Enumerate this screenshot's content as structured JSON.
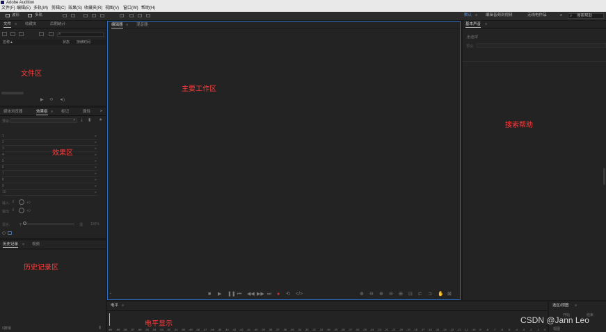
{
  "app": {
    "title": "Adobe Audition"
  },
  "menu": [
    "文件(F)",
    "编辑(E)",
    "多轨(M)",
    "剪辑(C)",
    "效果(S)",
    "收藏夹(R)",
    "视图(V)",
    "窗口(W)",
    "帮助(H)"
  ],
  "toolbar": {
    "waveform_label": "波形",
    "multitrack_label": "多轨",
    "workspace_default": "默认",
    "workspace_edit_video": "编辑音频到视频",
    "workspace_radio": "无线电作品",
    "search_placeholder": "搜索帮助"
  },
  "files_panel": {
    "tabs": [
      "文件",
      "收藏夹",
      "后期统计"
    ],
    "columns": {
      "name": "名称",
      "status": "状态",
      "duration": "持续时间"
    },
    "annotation": "文件区"
  },
  "effects_panel": {
    "tabs": [
      "媒体浏览器",
      "效果组",
      "标记",
      "属性"
    ],
    "preset_label": "预设:",
    "slots": [
      "1",
      "2",
      "3",
      "4",
      "5",
      "6",
      "7",
      "8",
      "9",
      "10"
    ],
    "input_label": "输入:",
    "output_label": "输出:",
    "gain_value": "+0",
    "mix_label": "混合:",
    "mix_left": "干",
    "mix_right": "湿",
    "mix_value": "100%",
    "annotation": "效果区"
  },
  "history_panel": {
    "tabs": [
      "历史记录",
      "视频"
    ],
    "status": "0撤销",
    "annotation": "历史记录区"
  },
  "editor_panel": {
    "tabs": [
      "编辑器",
      "混音器"
    ],
    "annotation": "主要工作区"
  },
  "essential_sound": {
    "tab": "基本声音",
    "no_selection": "无选择",
    "preset_label": "预设:",
    "annotation": "搜索帮助"
  },
  "levels_panel": {
    "tab": "电平",
    "annotation": "电平显示",
    "ruler": [
      "dB",
      "-59",
      "-58",
      "-57",
      "-56",
      "-55",
      "-54",
      "-53",
      "-52",
      "-51",
      "-50",
      "-49",
      "-48",
      "-47",
      "-46",
      "-45",
      "-44",
      "-43",
      "-42",
      "-41",
      "-40",
      "-39",
      "-38",
      "-37",
      "-36",
      "-35",
      "-34",
      "-33",
      "-32",
      "-31",
      "-30",
      "-29",
      "-28",
      "-27",
      "-26",
      "-25",
      "-24",
      "-23",
      "-22",
      "-21",
      "-20",
      "-19",
      "-18",
      "-17",
      "-16",
      "-15",
      "-14",
      "-13",
      "-12",
      "-11",
      "-10",
      "-9",
      "-8",
      "-7",
      "-6",
      "-5",
      "-4",
      "-3",
      "-2",
      "-1",
      "0"
    ]
  },
  "selection_panel": {
    "tab": "选区/视图",
    "start_label": "开始",
    "end_label": "结束",
    "view_label": "视图"
  },
  "watermark": "CSDN @Jann Leo",
  "colors": {
    "annotation": "#ff3a3a",
    "accent_border": "#2b6cc4",
    "record": "#e03030",
    "level_marker": "#c9c53a"
  }
}
